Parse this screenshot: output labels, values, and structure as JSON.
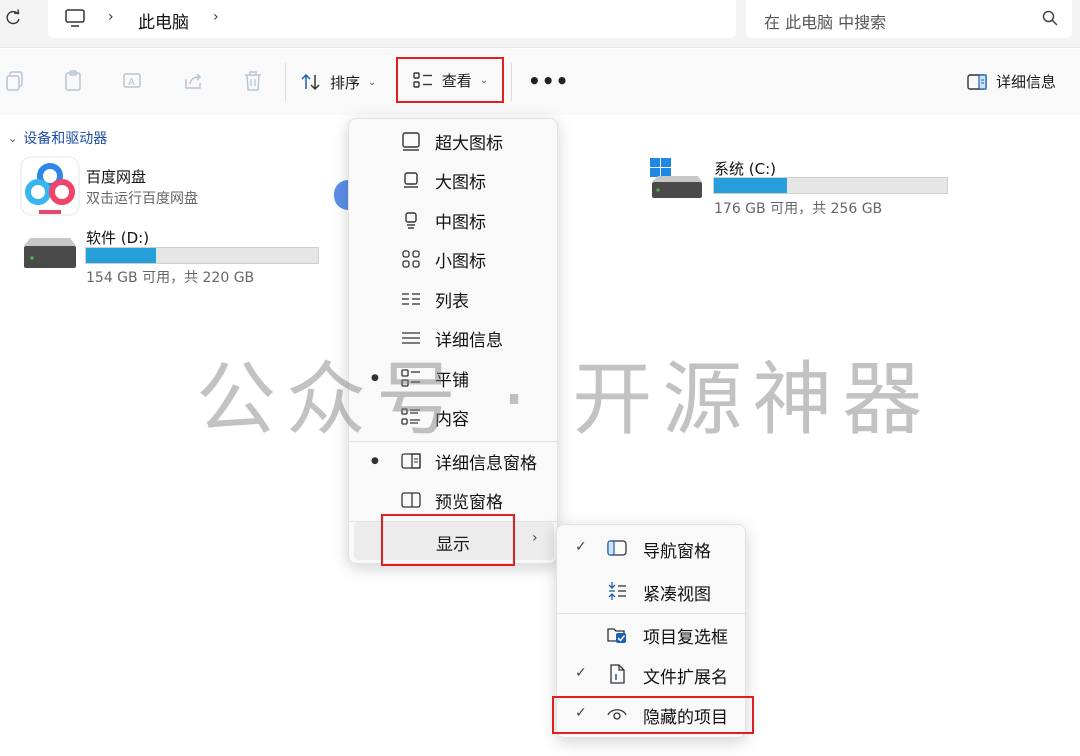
{
  "address": {
    "location": "此电脑",
    "search_placeholder": "在 此电脑 中搜索"
  },
  "toolbar": {
    "sort_label": "排序",
    "view_label": "查看",
    "more_label": "•••",
    "details_label": "详细信息"
  },
  "section": {
    "title": "设备和驱动器"
  },
  "items": {
    "baidu": {
      "name": "百度网盘",
      "sub": "双击运行百度网盘"
    },
    "drive_c": {
      "name": "系统 (C:)",
      "sub": "176 GB 可用，共 256 GB",
      "used_fraction": 0.3125
    },
    "drive_d": {
      "name": "软件 (D:)",
      "sub": "154 GB 可用，共 220 GB",
      "used_fraction": 0.3
    }
  },
  "view_menu": {
    "items": [
      "超大图标",
      "大图标",
      "中图标",
      "小图标",
      "列表",
      "详细信息",
      "平铺",
      "内容",
      "详细信息窗格",
      "预览窗格",
      "显示"
    ]
  },
  "show_submenu": {
    "items": [
      "导航窗格",
      "紧凑视图",
      "项目复选框",
      "文件扩展名",
      "隐藏的项目"
    ]
  },
  "watermark": "公众号 · 开源神器"
}
